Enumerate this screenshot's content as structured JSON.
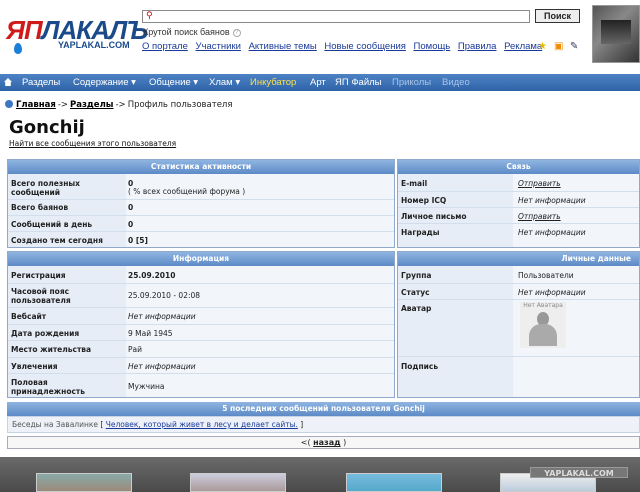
{
  "header": {
    "logo_text_red": "ЯП",
    "logo_text_blue": "ЛАКАЛЪ",
    "logo_subtext": "YAPLAKAL.COM",
    "search_placeholder": "",
    "search_button": "Поиск",
    "search_hint": "Крутой поиск баянов",
    "help_mark": "?",
    "top_links": [
      "О портале",
      "Участники",
      "Активные темы",
      "Новые сообщения",
      "Помощь",
      "Правила",
      "Реклама"
    ],
    "tool_icons": [
      "star-icon",
      "rss-icon",
      "pen-icon"
    ]
  },
  "navbar": {
    "items": [
      {
        "label": "Разделы",
        "state": "normal"
      },
      {
        "label": "Содержание ▾",
        "state": "normal"
      },
      {
        "label": "Общение ▾",
        "state": "normal"
      },
      {
        "label": "Хлам ▾",
        "state": "normal"
      },
      {
        "label": "Инкубатор",
        "state": "active"
      },
      {
        "label": "Арт",
        "state": "normal"
      },
      {
        "label": "ЯП Файлы",
        "state": "normal"
      },
      {
        "label": "Приколы",
        "state": "dim"
      },
      {
        "label": "Видео",
        "state": "dim"
      }
    ],
    "colors": {
      "bar": "#2f63a8",
      "active": "#ffe24a"
    }
  },
  "breadcrumb": {
    "items": [
      "Главная",
      "Разделы"
    ],
    "separator": "->",
    "current": "Профиль пользователя"
  },
  "profile": {
    "username": "Gonchij",
    "find_posts": "Найти все сообщения этого пользователя"
  },
  "stats": {
    "title": "Статистика активности",
    "rows": [
      {
        "label": "Всего полезных сообщений",
        "value": "0",
        "extra": "( % всех сообщений форума )"
      },
      {
        "label": "Всего баянов",
        "value": "0"
      },
      {
        "label": "Сообщений в день",
        "value": "0"
      },
      {
        "label": "Создано тем сегодня",
        "value": "0 [5]"
      }
    ]
  },
  "contact": {
    "title": "Связь",
    "rows": [
      {
        "label": "E-mail",
        "value": "Отправить"
      },
      {
        "label": "Номер ICQ",
        "value": "Нет информации"
      },
      {
        "label": "Личное письмо",
        "value": "Отправить"
      },
      {
        "label": "Награды",
        "value": "Нет информации"
      }
    ]
  },
  "info": {
    "title": "Информация",
    "rows": [
      {
        "label": "Регистрация",
        "value": "25.09.2010"
      },
      {
        "label": "Часовой пояс пользователя",
        "value": "25.09.2010 - 02:08"
      },
      {
        "label": "Вебсайт",
        "value": "Нет информации"
      },
      {
        "label": "Дата рождения",
        "value": "9 Май 1945"
      },
      {
        "label": "Место жительства",
        "value": "Рай"
      },
      {
        "label": "Увлечения",
        "value": "Нет информации"
      },
      {
        "label": "Половая принадлежность",
        "value": "Мужчина"
      }
    ]
  },
  "personal": {
    "title": "Личные данные",
    "group_label": "Группа",
    "group_value": "Пользователи",
    "status_label": "Статус",
    "status_value": "Нет информации",
    "avatar_label": "Аватар",
    "avatar_caption": "Нет Аватара",
    "signature_label": "Подпись"
  },
  "last_posts": {
    "title": "5 последних сообщений пользователя Gonchij",
    "forum": "Беседы на Завалинке",
    "open_bracket": "[",
    "link": "Человек, который живет в лесу и делает сайты.",
    "close_bracket": "]"
  },
  "pager": {
    "prefix": "<(",
    "link": "назад",
    "suffix": ")"
  },
  "bottom": {
    "logo": "YAPLAKAL.COM"
  }
}
